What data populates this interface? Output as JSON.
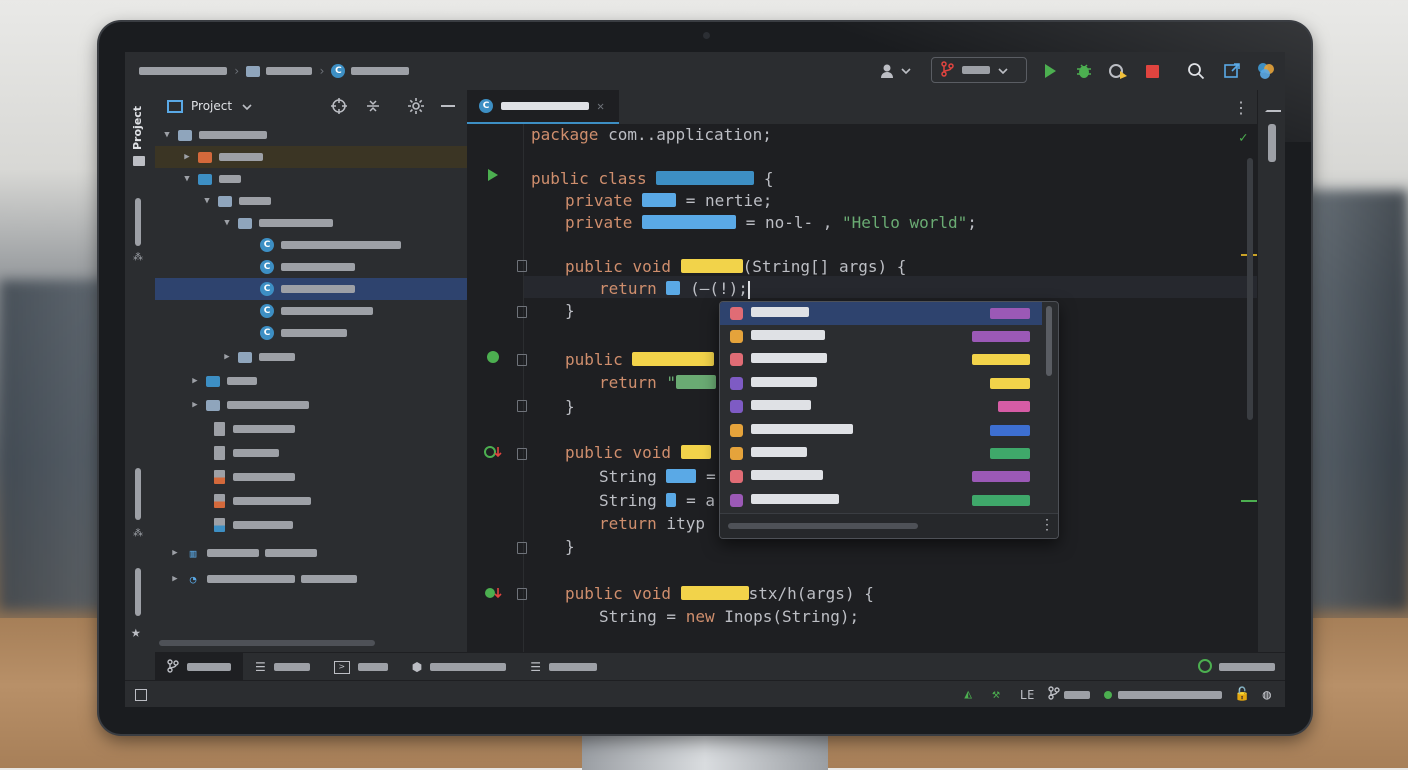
{
  "colors": {
    "accent": "#3d8fc4",
    "run_green": "#4caf50",
    "stop_red": "#e0443f",
    "keyword_orange": "#cf8e6d",
    "string_green": "#6aab73",
    "selection_blue": "#2e436e"
  },
  "project_panel": {
    "title": "Project"
  },
  "stripe": {
    "project_label": "Project"
  },
  "toolbar": {
    "icons": [
      "folder-icon",
      "class-icon",
      "user-icon",
      "branch-icon",
      "run-icon",
      "debug-icon",
      "profile-icon",
      "stop-icon",
      "search-icon",
      "open-external-icon",
      "ai-assistant-icon"
    ]
  },
  "editor": {
    "code": {
      "l1_kw": "package",
      "l1_rest": " com..application;",
      "l2_kw1": "public",
      "l2_kw2": "class",
      "l2_end": " {",
      "l3_kw": "private",
      "l3_rest": " = nertie;",
      "l4_kw": "private",
      "l4_mid": " = no-l- ,",
      "l4_str": " \"Hello world\"",
      "l4_end": ";",
      "l5_kw1": "public",
      "l5_kw2": "void",
      "l5_rest": "(String[] args) {",
      "l6_kw": "return",
      "l6_rest": " (—(!);",
      "l7": "}",
      "l8_kw": "public",
      "l9_kw": "return",
      "l9_str": " \"",
      "l10": "}",
      "l11_kw1": "public",
      "l11_kw2": "void",
      "l12": "String",
      "l12_rest": " =",
      "l13": "String",
      "l13_rest": " = a",
      "l14_kw": "return",
      "l14_rest": " ityp",
      "l15": "}",
      "l16_kw1": "public",
      "l16_kw2": "void",
      "l16_rest": "stx/h(args) {",
      "l17": "String",
      "l17_mid": " = ",
      "l17_kw": "new",
      "l17_rest": " Inops(String);"
    }
  },
  "completion_popup": {
    "rows": [
      {
        "icon_color": "#e06c75",
        "tail_color": "#9b59b6"
      },
      {
        "icon_color": "#e5a33b",
        "tail_color": "#9b59b6"
      },
      {
        "icon_color": "#e06c75",
        "tail_color": "#f2d34a"
      },
      {
        "icon_color": "#7e5bc4",
        "tail_color": "#f2d34a"
      },
      {
        "icon_color": "#7e5bc4",
        "tail_color": "#d65ca5"
      },
      {
        "icon_color": "#e5a33b",
        "tail_color": "#3d6fd1"
      },
      {
        "icon_color": "#e5a33b",
        "tail_color": "#3fa86a"
      },
      {
        "icon_color": "#e06c75",
        "tail_color": "#9b59b6"
      },
      {
        "icon_color": "#9b59b6",
        "tail_color": "#3fa86a"
      }
    ]
  }
}
